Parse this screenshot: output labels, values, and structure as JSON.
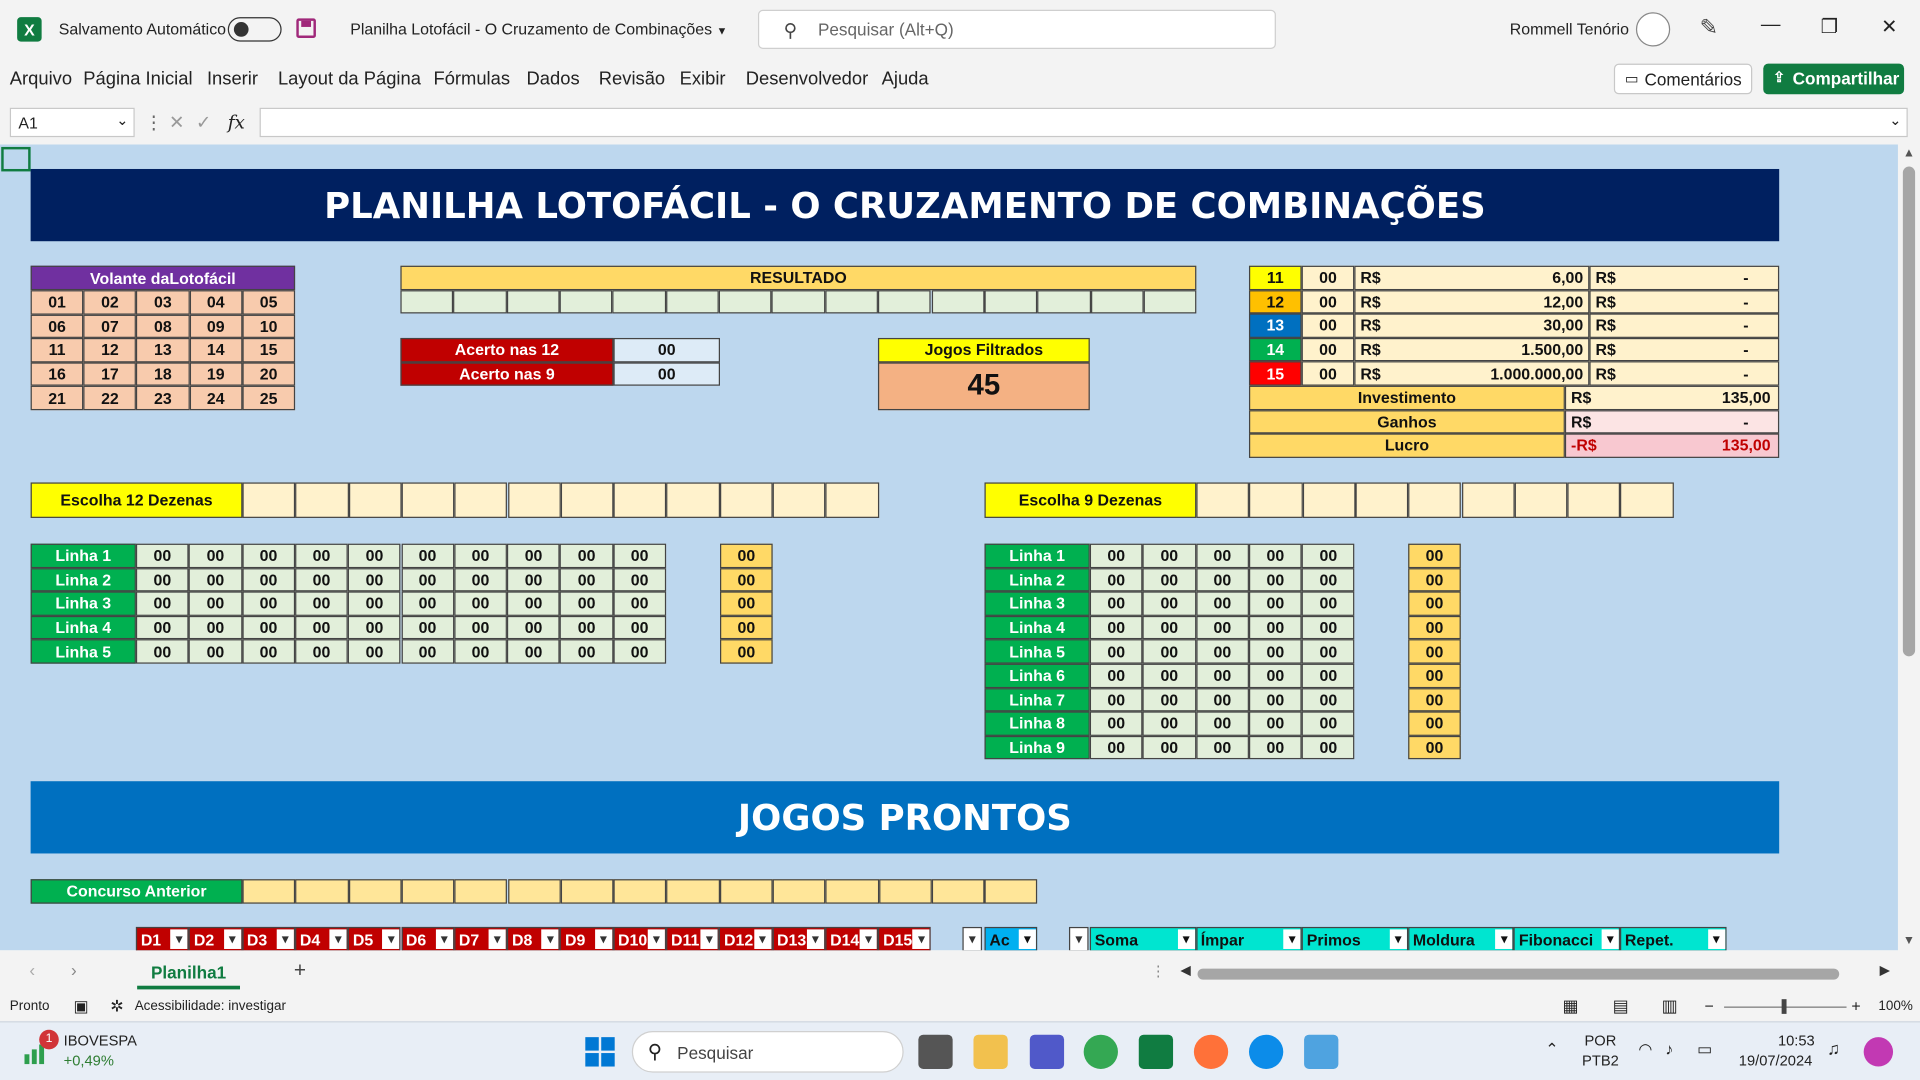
{
  "titlebar": {
    "autosave_label": "Salvamento Automático",
    "doc_title": "Planilha Lotofácil - O Cruzamento de Combinações",
    "search_placeholder": "Pesquisar (Alt+Q)",
    "user_name": "Rommell Tenório"
  },
  "menu": [
    "Arquivo",
    "Página Inicial",
    "Inserir",
    "Layout da Página",
    "Fórmulas",
    "Dados",
    "Revisão",
    "Exibir",
    "Desenvolvedor",
    "Ajuda"
  ],
  "buttons": {
    "comments": "Comentários",
    "share": "Compartilhar"
  },
  "formula": {
    "namebox": "A1",
    "fx": "fx"
  },
  "sheet": {
    "title": "PLANILHA LOTOFÁCIL - O CRUZAMENTO DE COMBINAÇÕES",
    "jogos_title": "JOGOS PRONTOS",
    "volante_title": "Volante daLotofácil",
    "volante": [
      [
        "01",
        "02",
        "03",
        "04",
        "05"
      ],
      [
        "06",
        "07",
        "08",
        "09",
        "10"
      ],
      [
        "11",
        "12",
        "13",
        "14",
        "15"
      ],
      [
        "16",
        "17",
        "18",
        "19",
        "20"
      ],
      [
        "21",
        "22",
        "23",
        "24",
        "25"
      ]
    ],
    "resultado_title": "RESULTADO",
    "acerto12_label": "Acerto nas 12",
    "acerto12_value": "00",
    "acerto9_label": "Acerto nas 9",
    "acerto9_value": "00",
    "jogos_filtrados_label": "Jogos Filtrados",
    "jogos_filtrados_value": "45",
    "prizes": [
      {
        "hits": "11",
        "count": "00",
        "currency": "R$",
        "value": "6,00",
        "currency2": "R$",
        "total": "-",
        "color": "#ffff00",
        "fg": "#111"
      },
      {
        "hits": "12",
        "count": "00",
        "currency": "R$",
        "value": "12,00",
        "currency2": "R$",
        "total": "-",
        "color": "#ffc000",
        "fg": "#111"
      },
      {
        "hits": "13",
        "count": "00",
        "currency": "R$",
        "value": "30,00",
        "currency2": "R$",
        "total": "-",
        "color": "#0070c0",
        "fg": "#fff"
      },
      {
        "hits": "14",
        "count": "00",
        "currency": "R$",
        "value": "1.500,00",
        "currency2": "R$",
        "total": "-",
        "color": "#00b050",
        "fg": "#fff"
      },
      {
        "hits": "15",
        "count": "00",
        "currency": "R$",
        "value": "1.000.000,00",
        "currency2": "R$",
        "total": "-",
        "color": "#ff0000",
        "fg": "#fff"
      }
    ],
    "summary": [
      {
        "label": "Investimento",
        "currency": "R$",
        "value": "135,00"
      },
      {
        "label": "Ganhos",
        "currency": "R$",
        "value": "-"
      },
      {
        "label": "Lucro",
        "currency": "-R$",
        "value": "135,00"
      }
    ],
    "escolha12_label": "Escolha 12 Dezenas",
    "escolha9_label": "Escolha 9 Dezenas",
    "linhas12": [
      "Linha 1",
      "Linha 2",
      "Linha 3",
      "Linha 4",
      "Linha 5"
    ],
    "linhas9": [
      "Linha 1",
      "Linha 2",
      "Linha 3",
      "Linha 4",
      "Linha 5",
      "Linha 6",
      "Linha 7",
      "Linha 8",
      "Linha 9"
    ],
    "zero": "00",
    "concurso_label": "Concurso Anterior",
    "headers_d": [
      "D1",
      "D2",
      "D3",
      "D4",
      "D5",
      "D6",
      "D7",
      "D8",
      "D9",
      "D10",
      "D11",
      "D12",
      "D13",
      "D14",
      "D15"
    ],
    "header_ac": "Ac",
    "headers_stats": [
      "Soma",
      "Ímpar",
      "Primos",
      "Moldura",
      "Fibonacci",
      "Repet."
    ]
  },
  "tabs": {
    "sheet1": "Planilha1",
    "add": "+"
  },
  "status": {
    "ready": "Pronto",
    "accessibility": "Acessibilidade: investigar",
    "zoom": "100%"
  },
  "taskbar": {
    "ticker": "IBOVESPA",
    "ticker_change": "+0,49%",
    "badge": "1",
    "search": "Pesquisar",
    "lang1": "POR",
    "lang2": "PTB2",
    "time": "10:53",
    "date": "19/07/2024"
  }
}
